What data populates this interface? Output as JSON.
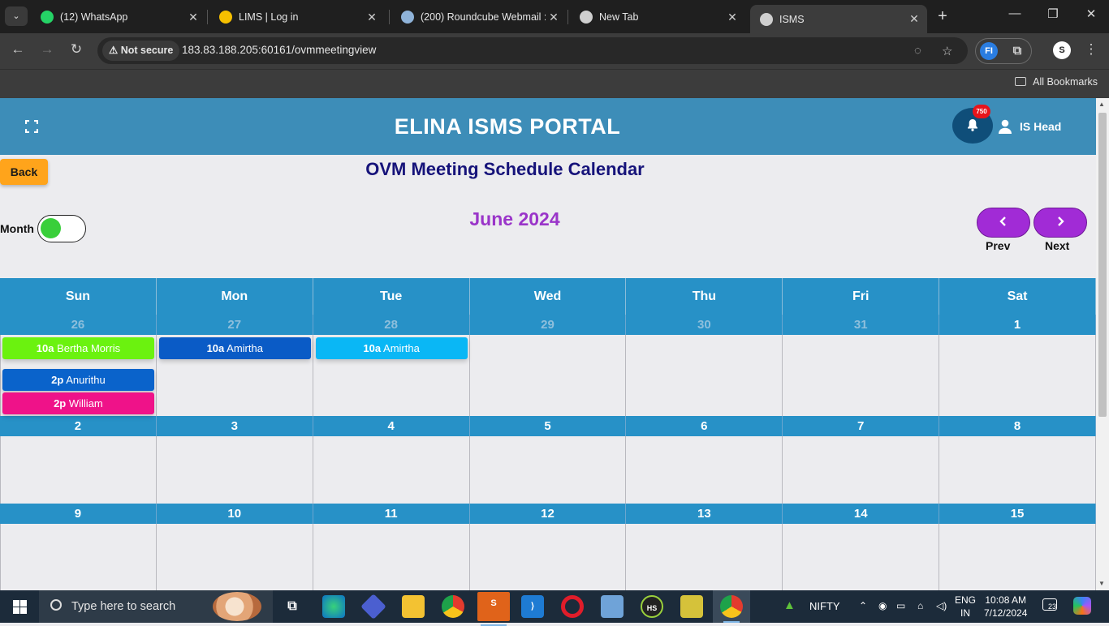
{
  "browser": {
    "tabs": [
      {
        "label": "(12) WhatsApp",
        "icon": "whatsapp-icon",
        "color": "#25d366"
      },
      {
        "label": "LIMS | Log in",
        "icon": "lims-icon",
        "color": "#f6c000"
      },
      {
        "label": "(200) Roundcube Webmail ::",
        "icon": "roundcube-icon",
        "color": "#8fb3d9"
      },
      {
        "label": "New Tab",
        "icon": "chrome-icon",
        "color": "#cfcfcf"
      },
      {
        "label": "ISMS",
        "icon": "globe-icon",
        "color": "#cfcfcf"
      }
    ],
    "security_label": "Not secure",
    "url": "183.83.188.205:60161/ovmmeetingview",
    "bookmarks_label": "All Bookmarks"
  },
  "header": {
    "brand": "ELINA ISMS PORTAL",
    "notification_count": "750",
    "user_name": "IS Head"
  },
  "page": {
    "back_label": "Back",
    "title": "OVM Meeting Schedule Calendar",
    "view_toggle_label": "Month",
    "view_toggle_on": true,
    "month_heading": "June 2024",
    "prev_label": "Prev",
    "next_label": "Next"
  },
  "calendar": {
    "weekdays": [
      "Sun",
      "Mon",
      "Tue",
      "Wed",
      "Thu",
      "Fri",
      "Sat"
    ],
    "weeks": [
      {
        "days": [
          {
            "n": "26",
            "other": true
          },
          {
            "n": "27",
            "other": true
          },
          {
            "n": "28",
            "other": true
          },
          {
            "n": "29",
            "other": true
          },
          {
            "n": "30",
            "other": true
          },
          {
            "n": "31",
            "other": true
          },
          {
            "n": "1",
            "other": false
          }
        ],
        "events": [
          {
            "day": 0,
            "slot": 0,
            "time": "10a",
            "title": "Bertha Morris",
            "color": "#6bf20f"
          },
          {
            "day": 0,
            "slot": 1,
            "time": "2p",
            "title": "Anurithu",
            "color": "#0a63cb"
          },
          {
            "day": 0,
            "slot": 2,
            "time": "2p",
            "title": "William",
            "color": "#ef1289"
          },
          {
            "day": 1,
            "slot": 0,
            "time": "10a",
            "title": "Amirtha",
            "color": "#0a5bc6"
          },
          {
            "day": 2,
            "slot": 0,
            "time": "10a",
            "title": "Amirtha",
            "color": "#0ab7f5"
          }
        ]
      },
      {
        "days": [
          {
            "n": "2",
            "other": false
          },
          {
            "n": "3",
            "other": false
          },
          {
            "n": "4",
            "other": false
          },
          {
            "n": "5",
            "other": false
          },
          {
            "n": "6",
            "other": false
          },
          {
            "n": "7",
            "other": false
          },
          {
            "n": "8",
            "other": false
          }
        ],
        "events": []
      },
      {
        "days": [
          {
            "n": "9",
            "other": false
          },
          {
            "n": "10",
            "other": false
          },
          {
            "n": "11",
            "other": false
          },
          {
            "n": "12",
            "other": false
          },
          {
            "n": "13",
            "other": false
          },
          {
            "n": "14",
            "other": false
          },
          {
            "n": "15",
            "other": false
          }
        ],
        "events": []
      }
    ]
  },
  "taskbar": {
    "search_placeholder": "Type here to search",
    "stock_label": "NIFTY",
    "lang_line1": "ENG",
    "lang_line2": "IN",
    "time": "10:08 AM",
    "date": "7/12/2024",
    "notification_count": "23"
  }
}
